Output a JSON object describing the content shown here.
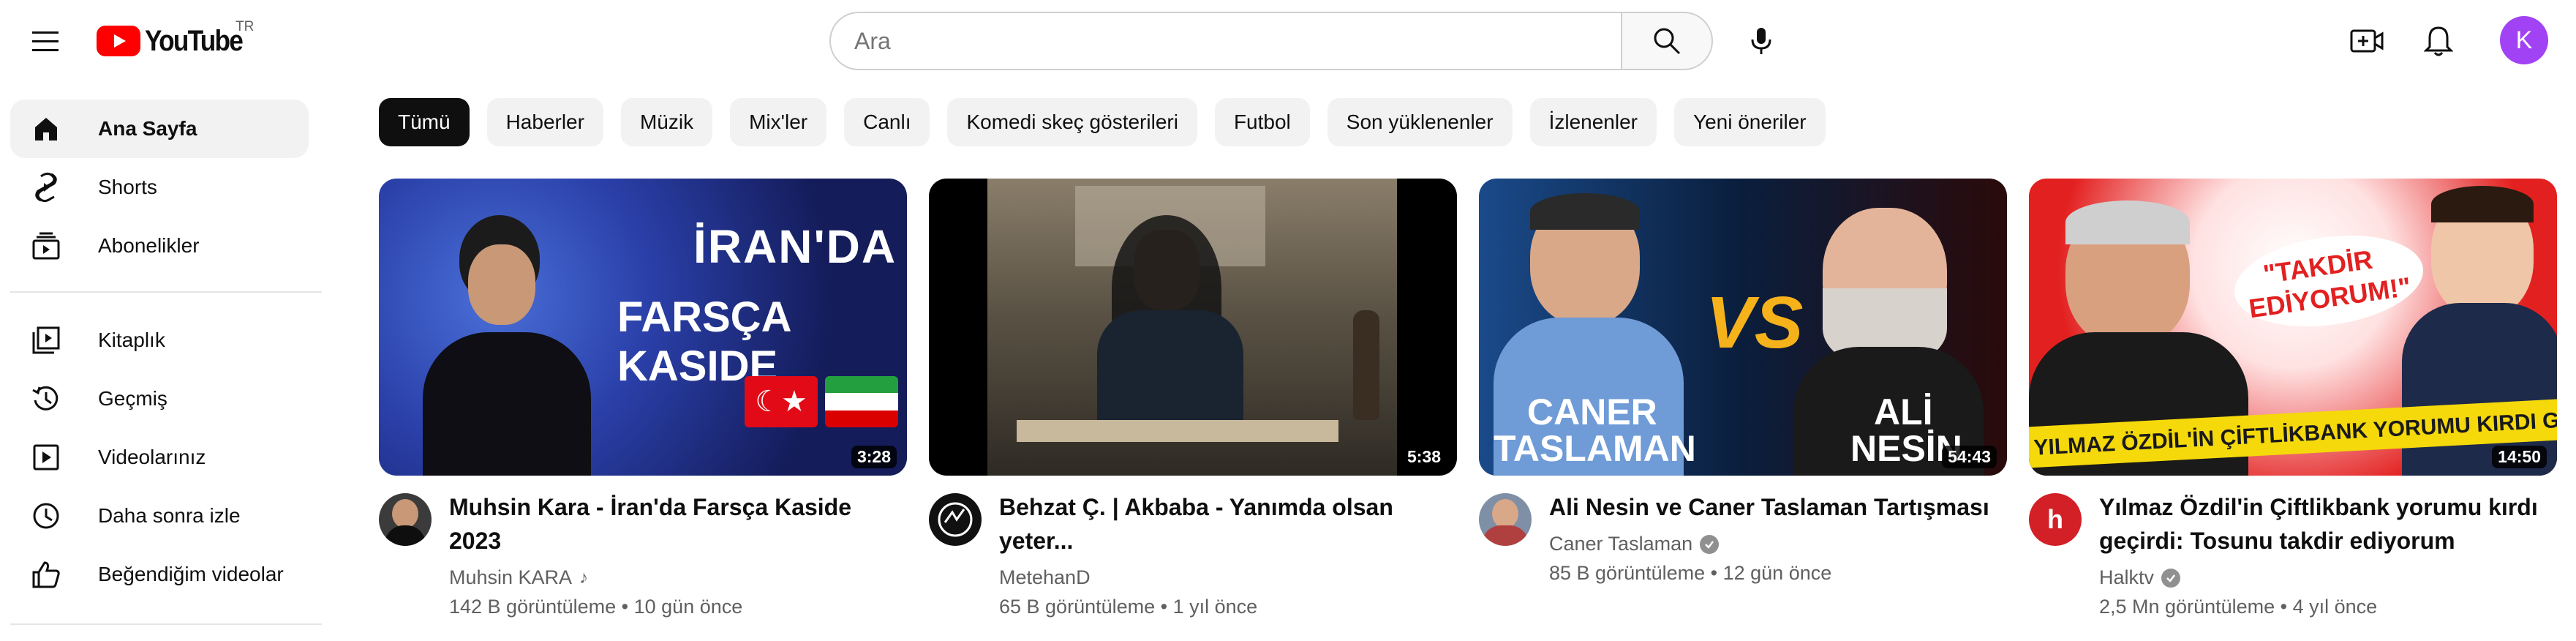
{
  "header": {
    "logo_text": "YouTube",
    "country": "TR",
    "search_placeholder": "Ara",
    "avatar_letter": "K",
    "colors": {
      "brand_red": "#ff0000",
      "avatar_bg": "#a142f4"
    }
  },
  "sidebar": {
    "items": [
      {
        "label": "Ana Sayfa",
        "icon": "home-icon",
        "active": true
      },
      {
        "label": "Shorts",
        "icon": "shorts-icon"
      },
      {
        "label": "Abonelikler",
        "icon": "subscriptions-icon"
      },
      {
        "label": "Kitaplık",
        "icon": "library-icon"
      },
      {
        "label": "Geçmiş",
        "icon": "history-icon"
      },
      {
        "label": "Videolarınız",
        "icon": "your-videos-icon"
      },
      {
        "label": "Daha sonra izle",
        "icon": "watch-later-icon"
      },
      {
        "label": "Beğendiğim videolar",
        "icon": "thumbs-up-icon"
      }
    ]
  },
  "chips": [
    "Tümü",
    "Haberler",
    "Müzik",
    "Mix'ler",
    "Canlı",
    "Komedi skeç gösterileri",
    "Futbol",
    "Son yüklenenler",
    "İzlenenler",
    "Yeni öneriler"
  ],
  "videos": [
    {
      "title": "Muhsin Kara - İran'da Farsça Kaside 2023",
      "channel": "Muhsin KARA",
      "views": "142 B görüntüleme",
      "age": "10 gün önce",
      "duration": "3:28",
      "thumb_text_1": "İRAN'DA",
      "thumb_text_2": "FARSÇA KASIDE"
    },
    {
      "title": "Behzat Ç. | Akbaba - Yanımda olsan yeter...",
      "channel": "MetehanD",
      "views": "65 B görüntüleme",
      "age": "1 yıl önce",
      "duration": "5:38"
    },
    {
      "title": "Ali Nesin ve Caner Taslaman Tartışması",
      "channel": "Caner Taslaman",
      "views": "85 B görüntüleme",
      "age": "12 gün önce",
      "duration": "54:43",
      "thumb_name_1a": "CANER",
      "thumb_name_1b": "TASLAMAN",
      "thumb_name_2a": "ALİ",
      "thumb_name_2b": "NESİN",
      "thumb_vs": "VS"
    },
    {
      "title": "Yılmaz Özdil'in Çiftlikbank yorumu kırdı geçirdi: Tosunu takdir ediyorum",
      "channel": "Halktv",
      "views": "2,5 Mn görüntüleme",
      "age": "4 yıl önce",
      "duration": "14:50",
      "thumb_banner": "YILMAZ ÖZDİL'İN ÇİFTLİKBANK YORUMU KIRDI GEÇİRDİ!",
      "thumb_bubble_1": "\"TAKDİR",
      "thumb_bubble_2": "EDİYORUM!\""
    }
  ]
}
